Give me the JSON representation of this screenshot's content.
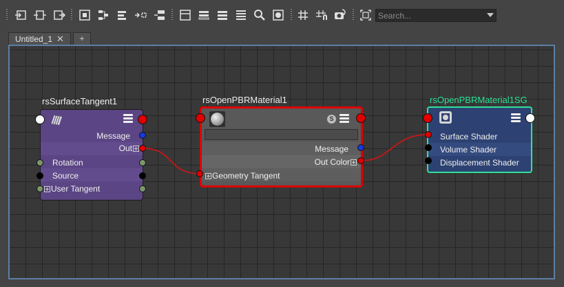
{
  "toolbar": {
    "search_placeholder": "Search..."
  },
  "tabs": [
    {
      "label": "Untitled_1",
      "close": "✕"
    },
    {
      "label": "+"
    }
  ],
  "nodes": {
    "surface_tangent": {
      "title": "rsSurfaceTangent1",
      "color": "#5b4584",
      "attributes": [
        "Message",
        "Out",
        "Rotation",
        "Source",
        "User Tangent"
      ]
    },
    "openpbr": {
      "title": "rsOpenPBRMaterial1",
      "color": "#595959",
      "highlight": "#e00000",
      "badge": "S",
      "attributes": [
        "Message",
        "Out Color",
        "Geometry Tangent"
      ]
    },
    "shading_group": {
      "title": "rsOpenPBRMaterial1SG",
      "color": "#2d4272",
      "highlight": "#2ee39a",
      "attributes": [
        "Surface Shader",
        "Volume Shader",
        "Displacement Shader"
      ]
    }
  },
  "colors": {
    "graph_background": "#383838",
    "grid": "#262626",
    "wire": "#b81a1a",
    "graph_border": "#5d7fa5"
  }
}
